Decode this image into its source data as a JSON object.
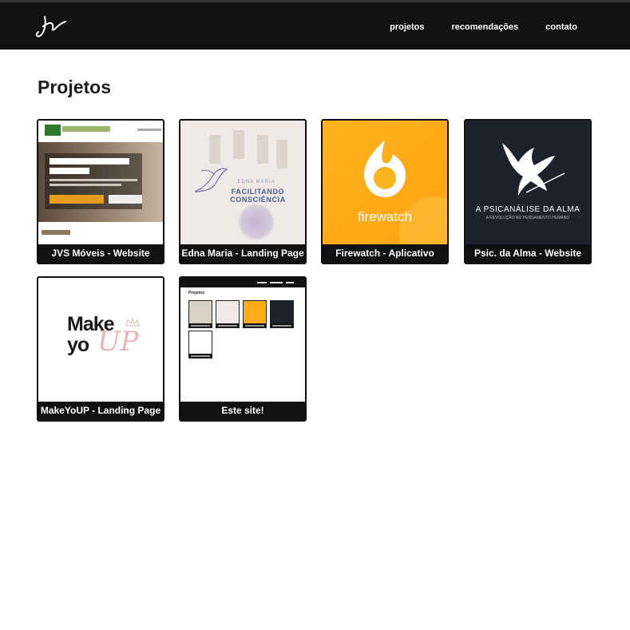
{
  "header": {
    "logo_icon": "signature-logo-icon",
    "nav": [
      {
        "label": "projetos"
      },
      {
        "label": "recomendações"
      },
      {
        "label": "contato"
      }
    ]
  },
  "main": {
    "title": "Projetos",
    "projects": [
      {
        "caption": "JVS Móveis - Website",
        "thumb": "jvs-moveis-website-preview"
      },
      {
        "caption": "Edna Maria - Landing Page",
        "thumb": "edna-maria-landing-preview",
        "thumb_text": {
          "name": "EDNA MARIA",
          "tagline": "FACILITANDO CONSCIÊNCIA"
        }
      },
      {
        "caption": "Firewatch - Aplicativo",
        "thumb": "firewatch-app-preview",
        "thumb_text": {
          "word": "firewatch"
        }
      },
      {
        "caption": "Psic. da Alma - Website",
        "thumb": "psicanalise-da-alma-preview",
        "thumb_text": {
          "name": "A PSICANÁLISE DA ALMA",
          "sub": "A REVOLUÇÃO NO PENSAMENTO HUMANO"
        }
      },
      {
        "caption": "MakeYoUP - Landing Page",
        "thumb": "makeyoup-logo-preview",
        "thumb_text": {
          "make": "Make",
          "yo": "yo",
          "up": "UP"
        }
      },
      {
        "caption": "Este site!",
        "thumb": "this-site-preview",
        "thumb_text": {
          "title": "Projetos"
        }
      }
    ]
  },
  "colors": {
    "topbar": "#111111",
    "firewatch_orange": "#ffad17",
    "psicanalise_bg": "#1d222c",
    "makeyoup_pink": "#e7b3b5"
  }
}
